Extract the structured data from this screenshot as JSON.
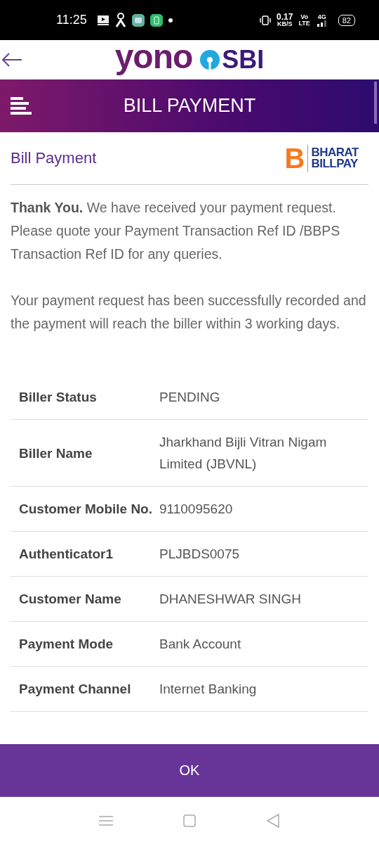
{
  "status_bar": {
    "time": "11:25",
    "speed": "0.17",
    "speed_unit": "KB/S",
    "volte": "Vo",
    "lte": "LTE",
    "network": "4G",
    "battery": "82"
  },
  "header": {
    "logo_left": "yono",
    "logo_right": "SBI"
  },
  "title_bar": {
    "title": "BILL PAYMENT"
  },
  "section": {
    "title": "Bill Payment",
    "badge_letter": "B",
    "badge_line1": "BHARAT",
    "badge_line2": "BILLPAY"
  },
  "messages": [
    "**Thank You.** We have received your payment request. Please quote your Payment Transaction Ref ID /BBPS Transaction Ref ID for any queries.",
    "Your payment request has been successfully recorded and the payment will reach the biller within 3 working days."
  ],
  "details": [
    {
      "label": "Biller Status",
      "value": "PENDING"
    },
    {
      "label": "Biller Name",
      "value": "Jharkhand Bijli Vitran Nigam Limited (JBVNL)"
    },
    {
      "label": "Customer Mobile No.",
      "value": "9110095620"
    },
    {
      "label": "Authenticator1",
      "value": "PLJBDS0075"
    },
    {
      "label": "Customer Name",
      "value": "DHANESHWAR SINGH"
    },
    {
      "label": "Payment Mode",
      "value": "Bank Account"
    },
    {
      "label": "Payment Channel",
      "value": "Internet Banking"
    }
  ],
  "ok_button": "OK"
}
